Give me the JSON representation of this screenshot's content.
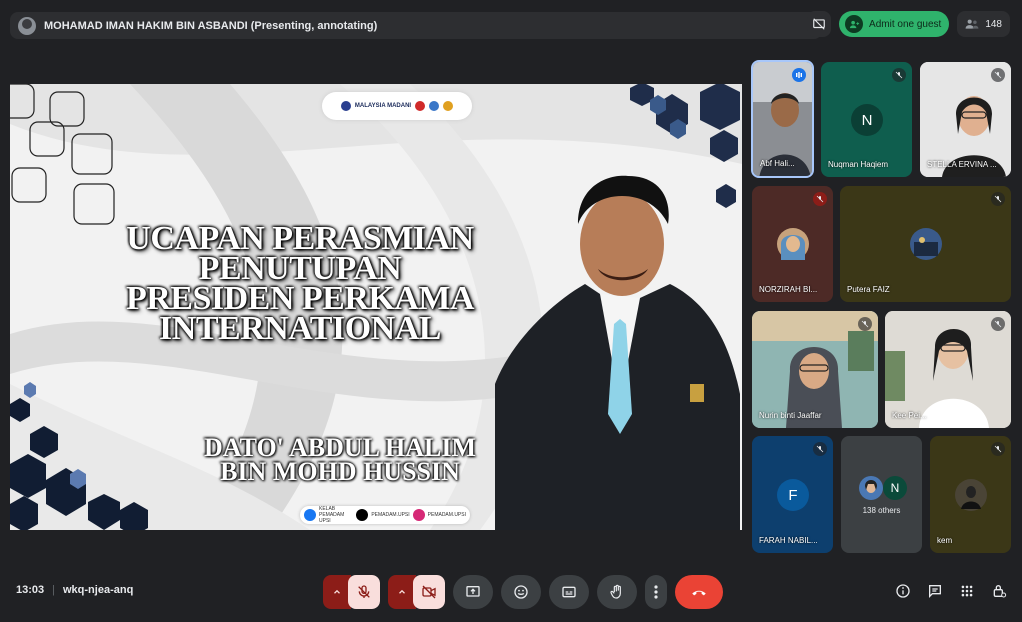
{
  "topbar": {
    "presenter_label": "MOHAMAD IMAN HAKIM BIN ASBANDI (Presenting, annotating)",
    "admit_label": "Admit one guest",
    "participant_count": "148"
  },
  "slide": {
    "title_lines": [
      "UCAPAN PERASMIAN",
      "PENUTUPAN",
      "PRESIDEN PERKAMA",
      "INTERNATIONAL"
    ],
    "name_lines": [
      "DATO' ABDUL HALIM",
      "BIN MOHD HUSSIN"
    ],
    "logo_text": "MALAYSIA MADANI",
    "social": [
      "KELAB PEMADAM UPSI",
      "PEMADAM.UPSI",
      "PEMADAM.UPSI"
    ]
  },
  "participants": [
    {
      "name": "Abf Hali...",
      "avatar": "",
      "muted": false,
      "speaking": true
    },
    {
      "name": "Nuqman Haqiem",
      "avatar": "N",
      "muted": true
    },
    {
      "name": "STELLA ERVINA ...",
      "avatar": "",
      "muted": true
    },
    {
      "name": "NORZIRAH BI...",
      "avatar": "",
      "muted": true
    },
    {
      "name": "Putera FAIZ",
      "avatar": "",
      "muted": true
    },
    {
      "name": "Nurin binti Jaaffar",
      "avatar": "",
      "muted": true
    },
    {
      "name": "Kee Pei...",
      "avatar": "",
      "muted": true
    },
    {
      "name": "FARAH NABIL...",
      "avatar": "F",
      "muted": true
    },
    {
      "name": "138 others",
      "avatar": "N",
      "muted": false
    },
    {
      "name": "kem",
      "avatar": "",
      "muted": true
    }
  ],
  "bottombar": {
    "time": "13:03",
    "meeting_code": "wkq-njea-anq"
  },
  "colors": {
    "background": "#202124",
    "end_call": "#ea4335",
    "admit": "#2fb36c",
    "muted_control": "#f9dedc"
  },
  "icons": [
    "meeting-avatar-icon",
    "present-off-icon",
    "person-add-icon",
    "people-icon",
    "mic-off-icon",
    "video-off-icon",
    "present-icon",
    "emoji-icon",
    "captions-icon",
    "raise-hand-icon",
    "more-icon",
    "end-call-icon",
    "info-icon",
    "chat-icon",
    "activities-icon",
    "host-controls-icon"
  ]
}
